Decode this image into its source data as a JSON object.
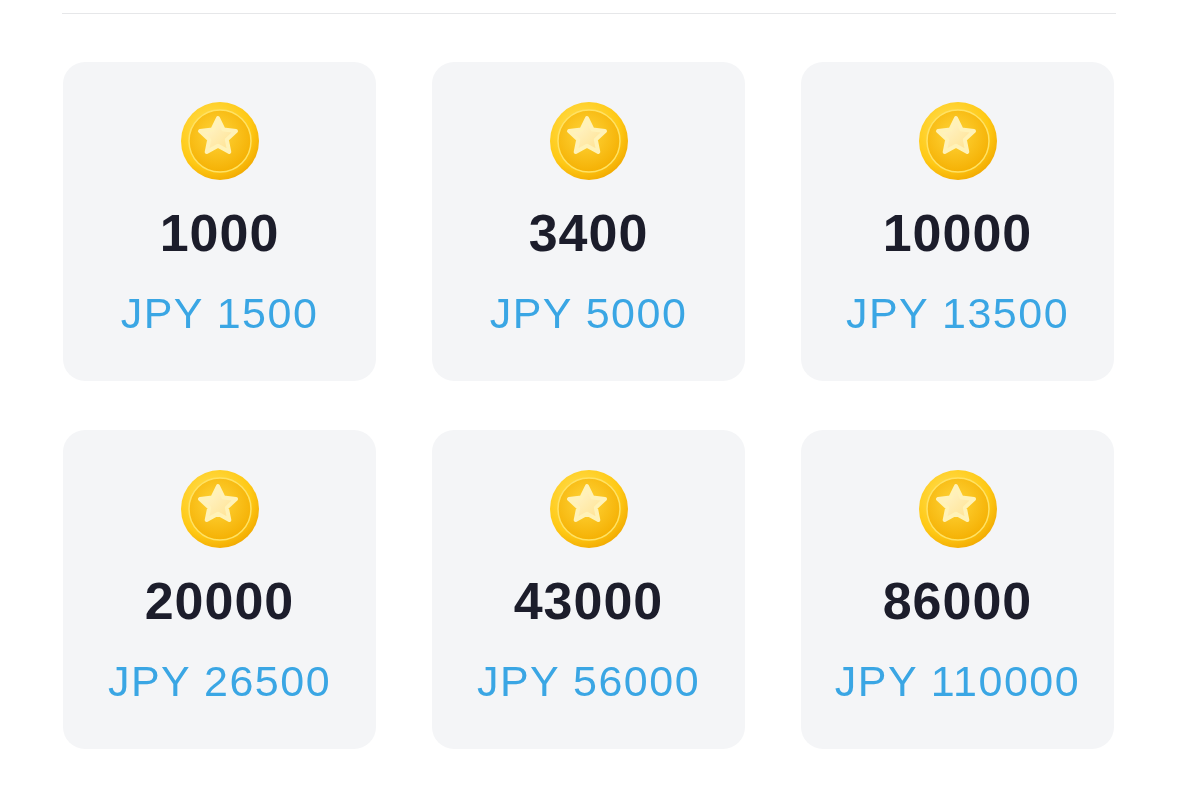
{
  "packages": [
    {
      "coins": "1000",
      "price": "JPY 1500"
    },
    {
      "coins": "3400",
      "price": "JPY 5000"
    },
    {
      "coins": "10000",
      "price": "JPY 13500"
    },
    {
      "coins": "20000",
      "price": "JPY 26500"
    },
    {
      "coins": "43000",
      "price": "JPY 56000"
    },
    {
      "coins": "86000",
      "price": "JPY 110000"
    }
  ]
}
